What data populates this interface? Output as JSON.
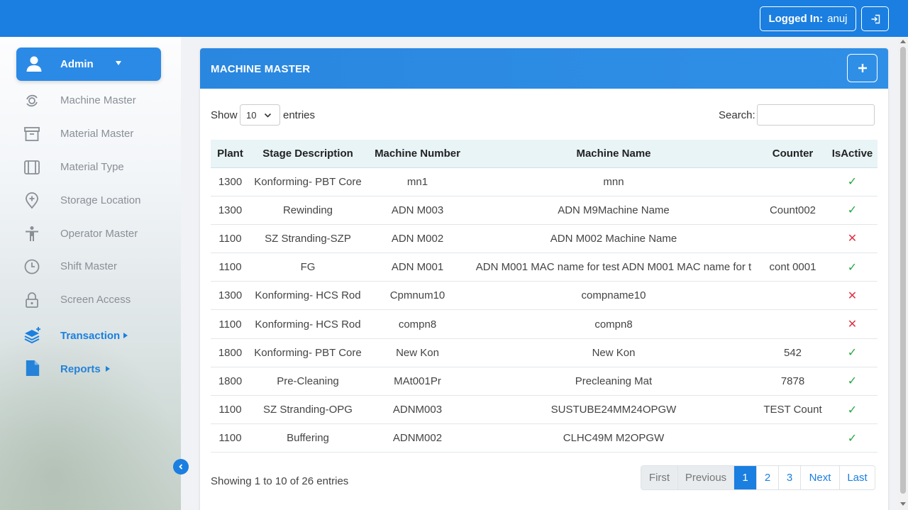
{
  "header": {
    "logged_in_label": "Logged In:",
    "username": "anuj",
    "logout_icon": "sign-out-icon"
  },
  "sidebar": {
    "admin": {
      "label": "Admin",
      "icon": "user-icon"
    },
    "items": [
      {
        "label": "Machine Master",
        "icon": "machine-icon"
      },
      {
        "label": "Material Master",
        "icon": "archive-icon"
      },
      {
        "label": "Material Type",
        "icon": "columns-icon"
      },
      {
        "label": "Storage Location",
        "icon": "map-pin-plus-icon"
      },
      {
        "label": "Operator Master",
        "icon": "person-icon"
      },
      {
        "label": "Shift Master",
        "icon": "clock-icon"
      },
      {
        "label": "Screen Access",
        "icon": "lock-icon"
      }
    ],
    "transaction": {
      "label": "Transaction",
      "icon": "layers-icon"
    },
    "reports": {
      "label": "Reports",
      "icon": "file-icon"
    }
  },
  "card": {
    "title": "MACHINE MASTER",
    "show_label": "Show",
    "page_length": "10",
    "entries_label": "entries",
    "search_label": "Search:",
    "search_value": ""
  },
  "table": {
    "columns": [
      "Plant",
      "Stage Description",
      "Machine Number",
      "Machine Name",
      "Counter",
      "IsActive"
    ],
    "rows": [
      {
        "plant": "1300",
        "stage": "Konforming- PBT Core",
        "number": "mn1",
        "name": "mnn",
        "counter": "",
        "active": true
      },
      {
        "plant": "1300",
        "stage": "Rewinding",
        "number": "ADN M003",
        "name": "ADN M9Machine Name",
        "counter": "Count002",
        "active": true
      },
      {
        "plant": "1100",
        "stage": "SZ Stranding-SZP",
        "number": "ADN M002",
        "name": "ADN M002 Machine Name",
        "counter": "",
        "active": false
      },
      {
        "plant": "1100",
        "stage": "FG",
        "number": "ADN M001",
        "name": "ADN M001 MAC name for test ADN M001 MAC name for t",
        "counter": "cont 0001",
        "active": true
      },
      {
        "plant": "1300",
        "stage": "Konforming- HCS Rod",
        "number": "Cpmnum10",
        "name": "compname10",
        "counter": "",
        "active": false
      },
      {
        "plant": "1100",
        "stage": "Konforming- HCS Rod",
        "number": "compn8",
        "name": "compn8",
        "counter": "",
        "active": false
      },
      {
        "plant": "1800",
        "stage": "Konforming- PBT Core",
        "number": "New Kon",
        "name": "New Kon",
        "counter": "542",
        "active": true
      },
      {
        "plant": "1800",
        "stage": "Pre-Cleaning",
        "number": "MAt001Pr",
        "name": "Precleaning Mat",
        "counter": "7878",
        "active": true
      },
      {
        "plant": "1100",
        "stage": "SZ Stranding-OPG",
        "number": "ADNM003",
        "name": "SUSTUBE24MM24OPGW",
        "counter": "TEST Count",
        "active": true
      },
      {
        "plant": "1100",
        "stage": "Buffering",
        "number": "ADNM002",
        "name": "CLHC49M M2OPGW",
        "counter": "",
        "active": true
      }
    ]
  },
  "footer": {
    "info": "Showing 1 to 10 of 26 entries",
    "pages": [
      "First",
      "Previous",
      "1",
      "2",
      "3",
      "Next",
      "Last"
    ],
    "current_page": "1"
  },
  "colors": {
    "primary": "#1a7fe0",
    "active_check": "#28a745",
    "inactive_x": "#dc3545",
    "table_header_bg": "#e8f4f6"
  }
}
